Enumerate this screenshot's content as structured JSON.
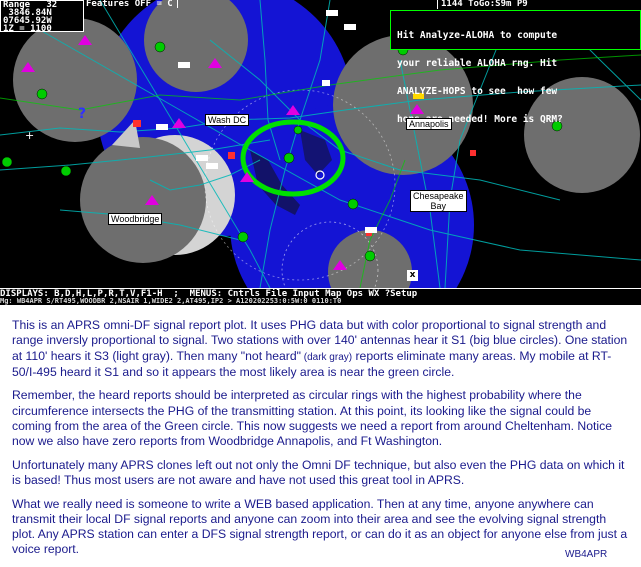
{
  "header": {
    "readout": [
      "Range   32",
      " 3846.84N",
      "07645.92W",
      "1Z = 1100"
    ],
    "features": "Features OFF = C",
    "tocount": "1144 ToGo:S9m P9",
    "aloha": [
      "Hit Analyze-ALOHA to compute",
      "your reliable ALOHA rng. Hit",
      "ANALYZE-HOPS to see  how few",
      "hops are needed! More is QRM?"
    ]
  },
  "map": {
    "labels": {
      "washdc": "Wash DC",
      "annapolis": "Annapolis",
      "chesapeake_line1": "Chesapeake",
      "chesapeake_line2": "Bay",
      "woodbridge": "Woodbridge"
    },
    "colors": {
      "background": "#000000",
      "strong_signal": "#1414d4",
      "s3_signal": "#d4d4d4",
      "not_heard": "#6e6e6e",
      "likely_area": "#00e000",
      "roads": "#00b8b8"
    },
    "close_box": "x"
  },
  "menubar": "DISPLAYS: B,D,H,L,P,R,T,V,F1-H  ;  MENUS: Cntrls File Input Map Ops WX ?Setup",
  "statusbar": "Mg: WB4APR S/RT495,WOODBR 2,NSAIR 1,WIDE2 2,AT495,IP2 > A120202253:0:5W:0 0110:T0",
  "caption": {
    "p1": "This is an APRS omni-DF signal report plot.  It uses PHG data but with color proportional to signal strength and range inversly proportional to signal.  Two stations with over 140' antennas hear it S1 (big blue circles).  One station at 110' hears it S3 (light gray).  Then many \"not heard\"",
    "p1_small": " (dark gray)",
    "p1_tail": " reports eliminate many areas.  My mobile at RT-50/I-495 heard it S1 and so it appears the most likely area is near the green circle.",
    "p2": "Remember, the heard reports should be interpreted as circular rings with the highest probability where the circumference intersects the PHG of the transmitting station.  At this point, its looking like the signal could be coming from the area of the Green circle.  This now suggests we need a report from  around Cheltenham.  Notice now we also have zero reports  from Woodbridge Annapolis, and Ft Washington.",
    "p3": "Unfortunately many APRS clones left out not only the Omni DF technique, but also even the PHG data on which it is based!  Thus most users are not aware and have not used this great tool in APRS.",
    "p4": "What we really need is someone to write a WEB based application.  Then at any time, anyone anywhere can transmit their local DF signal reports and anyone can zoom into their area and see the evolving signal strength plot.   Any APRS station can enter a DFS signal strength report, or can do it as an object for anyone else from just a voice report.",
    "signature": "WB4APR"
  }
}
